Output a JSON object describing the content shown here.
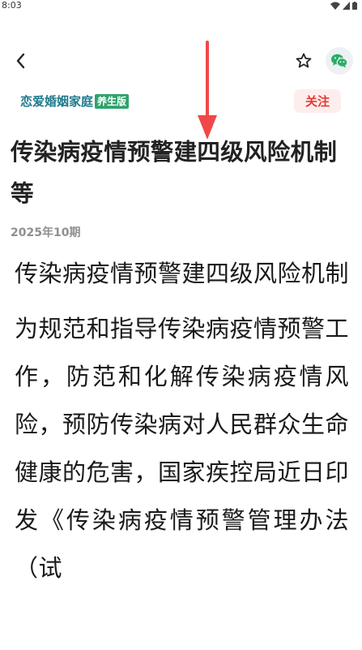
{
  "status_bar": {
    "time": "8:03"
  },
  "nav": {
    "back_icon": "chevron-left-icon",
    "favorite_icon": "star-outline-icon",
    "share_icon": "wechat-icon"
  },
  "magazine": {
    "logo_main": "恋爱婚姻家庭",
    "logo_sub": "养生版",
    "follow_label": "关注"
  },
  "article": {
    "title": "传染病疫情预警建四级风险机制 等",
    "issue": "2025年10期",
    "heading": "传染病疫情预警建四级风险机制",
    "paragraph": "为规范和指导传染病疫情预警工作，防范和化解传染病疫情风险，预防传染病对人民群众生命健康的危害，国家疾控局近日印发《传染病疫情预警管理办法（试"
  },
  "colors": {
    "follow_text": "#e23b32",
    "follow_bg": "#fdeeed",
    "logo_teal": "#1f7a8c",
    "logo_green": "#2ea36b",
    "annotation_arrow": "#f04848"
  }
}
